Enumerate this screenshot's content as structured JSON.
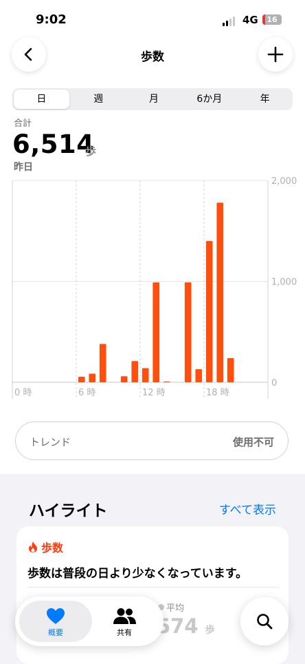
{
  "status_bar": {
    "time": "9:02",
    "network": "4G",
    "battery": "16",
    "battery_level": 0.16
  },
  "nav": {
    "title": "歩数",
    "back_icon": "chevron-left-icon",
    "add_icon": "plus-icon"
  },
  "segments": {
    "items": [
      "日",
      "週",
      "月",
      "6か月",
      "年"
    ],
    "selected": "日"
  },
  "summary": {
    "label": "合計",
    "value": "6,514",
    "unit": "歩",
    "date": "昨日"
  },
  "chart_data": {
    "type": "bar",
    "x": [
      6,
      7,
      8,
      10,
      11,
      12,
      13,
      14,
      16,
      17,
      18,
      19,
      20
    ],
    "values": [
      55,
      85,
      380,
      60,
      210,
      140,
      990,
      8,
      990,
      130,
      1400,
      1780,
      240
    ],
    "xlabel": "",
    "ylabel": "",
    "xlim": [
      0,
      24
    ],
    "ylim": [
      0,
      2000
    ],
    "x_ticks": [
      "0 時",
      "6 時",
      "12 時",
      "18 時"
    ],
    "y_ticks": [
      "2,000",
      "1,000",
      "0"
    ],
    "bar_color": "#ff4f0f",
    "grid": true
  },
  "trend": {
    "label": "トレンド",
    "value": "使用不可"
  },
  "highlights": {
    "title": "ハイライト",
    "show_all": "すべて表示"
  },
  "card": {
    "icon": "flame-icon",
    "title": "歩数",
    "body": "歩数は普段の日より少なくなっています。",
    "avg_label": "平均",
    "avg_value": "574",
    "avg_unit": "歩"
  },
  "tabbar": {
    "items": [
      {
        "label": "概要",
        "icon": "heart-icon"
      },
      {
        "label": "共有",
        "icon": "people-icon"
      }
    ],
    "search_icon": "search-icon"
  },
  "colors": {
    "accent": "#007aff",
    "bar": "#ff4f0f"
  }
}
